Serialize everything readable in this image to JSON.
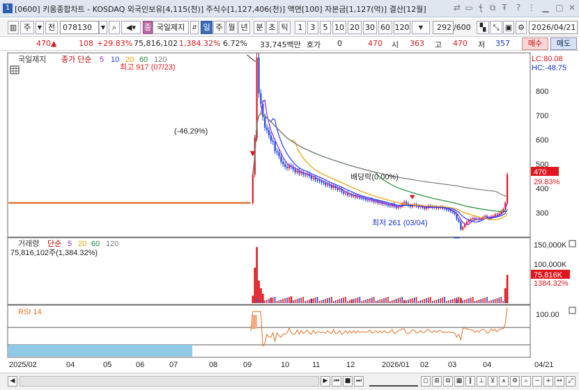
{
  "window": {
    "number": "1",
    "title": "[0600] 키움종합차트 - KOSDAQ 외국인보유[4,115(천)] 주식수[1,127,406(천)] 액면[100] 자본금[1,127(억)] 결산[12월]",
    "icons": [
      "link-icon",
      "window-icon",
      "text-icon",
      "settings-text-icon",
      "help-icon",
      "minimize-icon",
      "maximize-icon",
      "close-icon"
    ]
  },
  "toolbar": {
    "market": "주",
    "period_prev": "전",
    "code": "078130",
    "issue_label": "국일제지",
    "tabs": [
      "일",
      "주",
      "월",
      "년",
      "분",
      "초",
      "틱"
    ],
    "active_tab": "일",
    "intervals": [
      "1",
      "3",
      "5",
      "10",
      "20",
      "30",
      "60",
      "120"
    ],
    "count": "292",
    "count_max": "/600",
    "date": "2026/04/21"
  },
  "pricebar": {
    "price": "470",
    "change": "108",
    "change_pct": "+29.83%",
    "volume": "75,816,102",
    "volume_pct": "1,384.32%",
    "turnover_pct": "6.72%",
    "amount": "33,745백만",
    "quote_label": "호가",
    "quote": "0",
    "quote_price": "470",
    "open_label": "시",
    "open": "363",
    "high_label": "고",
    "high": "470",
    "low_label": "저",
    "low": "357",
    "buy_label": "매수",
    "sell_label": "매도"
  },
  "colors": {
    "up": "#e0161c",
    "down": "#1846d8",
    "ma5": "#8a2be2",
    "ma10": "#1e3cff",
    "ma20": "#e6a000",
    "ma60": "#1c8a3a",
    "ma120": "#7a7a7a",
    "rsi": "#e07020",
    "panel_border": "#6a6a6a"
  },
  "price_panel": {
    "legend_name": "국일제지",
    "legend_type": "종가 단순",
    "legend_periods": [
      "5",
      "10",
      "20",
      "60",
      "120"
    ],
    "lc": "LC:80.08",
    "hc": "HC:-48.75",
    "high_note": "최고 917 (07/23)",
    "low_note": "최저 261 (03/04)",
    "dividend_note": "배당락(0.00%)",
    "drop_note": "(-46.29%)",
    "last_price_tag": "470",
    "last_pct_tag": "29.83%",
    "y_ticks": [
      "800",
      "700",
      "600",
      "500",
      "400",
      "300"
    ]
  },
  "volume_panel": {
    "legend_name": "거래량",
    "legend_type": "단순",
    "legend_periods": [
      "5",
      "20",
      "60",
      "120"
    ],
    "value_label": "75,816,102주(1,384.32%)",
    "y_ticks": [
      "150,000K",
      "100,000K"
    ],
    "last_tag": "75,816K",
    "last_pct": "1384.32%"
  },
  "rsi_panel": {
    "legend": "RSI 14",
    "y_tick": "100.00"
  },
  "x_axis": {
    "labels": [
      "2025/02",
      "04",
      "05",
      "06",
      "07",
      "08",
      "09",
      "10",
      "11",
      "12",
      "2026/01",
      "02",
      "03",
      "04"
    ],
    "right_label": "04/21"
  },
  "chart_data": {
    "type": "candlestick",
    "series_note": "daily candles with moving averages",
    "ylim": [
      245,
      930
    ],
    "annotations": {
      "high": 917,
      "low": 261,
      "last": 470
    },
    "price_path": [
      [
        0,
        362
      ],
      [
        1,
        362
      ],
      [
        2,
        362
      ],
      [
        3,
        362
      ],
      [
        4,
        362
      ],
      [
        5,
        362
      ],
      [
        6,
        362
      ],
      [
        7,
        362
      ],
      [
        8,
        362
      ],
      [
        9,
        362
      ],
      [
        10,
        362
      ],
      [
        11,
        362
      ],
      [
        12,
        362
      ],
      [
        13,
        362
      ],
      [
        14,
        362
      ],
      [
        15,
        362
      ],
      [
        16,
        362
      ],
      [
        17,
        362
      ],
      [
        18,
        362
      ],
      [
        19,
        362
      ],
      [
        20,
        362
      ],
      [
        21,
        362
      ],
      [
        22,
        362
      ],
      [
        23,
        362
      ],
      [
        24,
        362
      ],
      [
        25,
        362
      ],
      [
        26,
        362
      ],
      [
        27,
        362
      ],
      [
        28,
        362
      ],
      [
        29,
        362
      ],
      [
        30,
        362
      ],
      [
        31,
        362
      ],
      [
        32,
        362
      ],
      [
        33,
        362
      ],
      [
        34,
        362
      ],
      [
        35,
        362
      ],
      [
        36,
        362
      ],
      [
        37,
        362
      ],
      [
        38,
        362
      ],
      [
        39,
        362
      ],
      [
        40,
        362
      ],
      [
        41,
        362
      ],
      [
        42,
        362
      ],
      [
        43,
        362
      ],
      [
        44,
        362
      ],
      [
        45,
        362
      ],
      [
        46,
        362
      ],
      [
        47,
        362
      ],
      [
        48,
        362
      ],
      [
        49,
        362
      ],
      [
        50,
        362
      ],
      [
        51,
        362
      ],
      [
        52,
        362
      ],
      [
        53,
        362
      ],
      [
        54,
        362
      ],
      [
        55,
        362
      ],
      [
        56,
        362
      ],
      [
        57,
        362
      ],
      [
        58,
        362
      ],
      [
        59,
        362
      ],
      [
        60,
        362
      ],
      [
        61,
        362
      ],
      [
        62,
        362
      ],
      [
        63,
        362
      ],
      [
        64,
        362
      ],
      [
        65,
        362
      ],
      [
        66,
        362
      ],
      [
        67,
        362
      ],
      [
        68,
        362
      ],
      [
        69,
        362
      ],
      [
        70,
        362
      ],
      [
        71,
        362
      ],
      [
        72,
        362
      ],
      [
        73,
        362
      ],
      [
        74,
        362
      ],
      [
        75,
        362
      ],
      [
        76,
        362
      ],
      [
        77,
        362
      ],
      [
        78,
        362
      ],
      [
        79,
        362
      ],
      [
        80,
        362
      ],
      [
        81,
        362
      ],
      [
        82,
        362
      ],
      [
        83,
        362
      ],
      [
        84,
        362
      ],
      [
        85,
        362
      ],
      [
        86,
        362
      ],
      [
        87,
        362
      ],
      [
        88,
        362
      ],
      [
        89,
        362
      ],
      [
        90,
        362
      ],
      [
        91,
        362
      ],
      [
        92,
        362
      ],
      [
        93,
        362
      ],
      [
        94,
        362
      ],
      [
        95,
        362
      ],
      [
        96,
        362
      ],
      [
        97,
        362
      ],
      [
        98,
        362
      ],
      [
        99,
        362
      ],
      [
        100,
        362
      ],
      [
        101,
        362
      ],
      [
        102,
        362
      ],
      [
        103,
        362
      ],
      [
        104,
        362
      ],
      [
        105,
        362
      ],
      [
        106,
        362
      ],
      [
        107,
        362
      ],
      [
        108,
        362
      ],
      [
        109,
        362
      ],
      [
        110,
        362
      ],
      [
        111,
        362
      ],
      [
        112,
        362
      ],
      [
        113,
        362
      ],
      [
        114,
        362
      ],
      [
        115,
        362
      ],
      [
        116,
        362
      ],
      [
        117,
        362
      ],
      [
        118,
        362
      ],
      [
        119,
        362
      ],
      [
        120,
        362
      ],
      [
        121,
        470
      ],
      [
        122,
        610
      ],
      [
        123,
        917
      ],
      [
        124,
        780
      ],
      [
        125,
        740
      ],
      [
        126,
        690
      ],
      [
        127,
        650
      ],
      [
        128,
        640
      ],
      [
        129,
        620
      ],
      [
        130,
        600
      ],
      [
        131,
        595
      ],
      [
        132,
        560
      ],
      [
        133,
        555
      ],
      [
        134,
        540
      ],
      [
        135,
        520
      ],
      [
        136,
        510
      ],
      [
        137,
        500
      ],
      [
        138,
        495
      ],
      [
        139,
        505
      ],
      [
        140,
        500
      ],
      [
        141,
        490
      ],
      [
        142,
        480
      ],
      [
        143,
        485
      ],
      [
        144,
        475
      ],
      [
        145,
        478
      ],
      [
        146,
        470
      ],
      [
        147,
        468
      ],
      [
        148,
        472
      ],
      [
        149,
        465
      ],
      [
        150,
        455
      ],
      [
        151,
        458
      ],
      [
        152,
        450
      ],
      [
        153,
        448
      ],
      [
        154,
        445
      ],
      [
        155,
        440
      ],
      [
        156,
        438
      ],
      [
        157,
        430
      ],
      [
        158,
        432
      ],
      [
        159,
        428
      ],
      [
        160,
        420
      ],
      [
        161,
        426
      ],
      [
        162,
        418
      ],
      [
        163,
        412
      ],
      [
        164,
        415
      ],
      [
        165,
        405
      ],
      [
        166,
        398
      ],
      [
        167,
        400
      ],
      [
        168,
        392
      ],
      [
        169,
        394
      ],
      [
        170,
        388
      ],
      [
        171,
        390
      ],
      [
        172,
        384
      ],
      [
        173,
        386
      ],
      [
        174,
        382
      ],
      [
        175,
        380
      ],
      [
        176,
        378
      ],
      [
        177,
        374
      ],
      [
        178,
        372
      ],
      [
        179,
        376
      ],
      [
        180,
        370
      ],
      [
        181,
        366
      ],
      [
        182,
        368
      ],
      [
        183,
        362
      ],
      [
        184,
        364
      ],
      [
        185,
        358
      ],
      [
        186,
        360
      ],
      [
        187,
        356
      ],
      [
        188,
        352
      ],
      [
        189,
        350
      ],
      [
        190,
        356
      ],
      [
        191,
        348
      ],
      [
        192,
        344
      ],
      [
        193,
        346
      ],
      [
        194,
        350
      ],
      [
        195,
        358
      ],
      [
        196,
        366
      ],
      [
        197,
        360
      ],
      [
        198,
        352
      ],
      [
        199,
        348
      ],
      [
        200,
        352
      ],
      [
        201,
        356
      ],
      [
        202,
        350
      ],
      [
        203,
        346
      ],
      [
        204,
        348
      ],
      [
        205,
        344
      ],
      [
        206,
        340
      ],
      [
        207,
        344
      ],
      [
        208,
        350
      ],
      [
        209,
        348
      ],
      [
        210,
        344
      ],
      [
        211,
        346
      ],
      [
        212,
        342
      ],
      [
        213,
        344
      ],
      [
        214,
        346
      ],
      [
        215,
        342
      ],
      [
        216,
        340
      ],
      [
        217,
        336
      ],
      [
        218,
        334
      ],
      [
        219,
        330
      ],
      [
        220,
        326
      ],
      [
        221,
        320
      ],
      [
        222,
        300
      ],
      [
        223,
        290
      ],
      [
        224,
        261
      ],
      [
        225,
        270
      ],
      [
        226,
        282
      ],
      [
        227,
        290
      ],
      [
        228,
        296
      ],
      [
        229,
        300
      ],
      [
        230,
        304
      ],
      [
        231,
        300
      ],
      [
        232,
        302
      ],
      [
        233,
        298
      ],
      [
        234,
        302
      ],
      [
        235,
        308
      ],
      [
        236,
        312
      ],
      [
        237,
        306
      ],
      [
        238,
        302
      ],
      [
        239,
        310
      ],
      [
        240,
        312
      ],
      [
        241,
        318
      ],
      [
        242,
        316
      ],
      [
        243,
        322
      ],
      [
        244,
        330
      ],
      [
        245,
        338
      ],
      [
        246,
        362
      ],
      [
        247,
        470
      ]
    ],
    "volume_spikes": [
      [
        121,
        20
      ],
      [
        122,
        95
      ],
      [
        123,
        150
      ],
      [
        124,
        60
      ],
      [
        125,
        40
      ],
      [
        126,
        25
      ],
      [
        130,
        15
      ],
      [
        140,
        18
      ],
      [
        150,
        12
      ],
      [
        170,
        10
      ],
      [
        196,
        8
      ],
      [
        222,
        10
      ],
      [
        224,
        14
      ],
      [
        247,
        75.8
      ],
      [
        246,
        40
      ]
    ]
  }
}
